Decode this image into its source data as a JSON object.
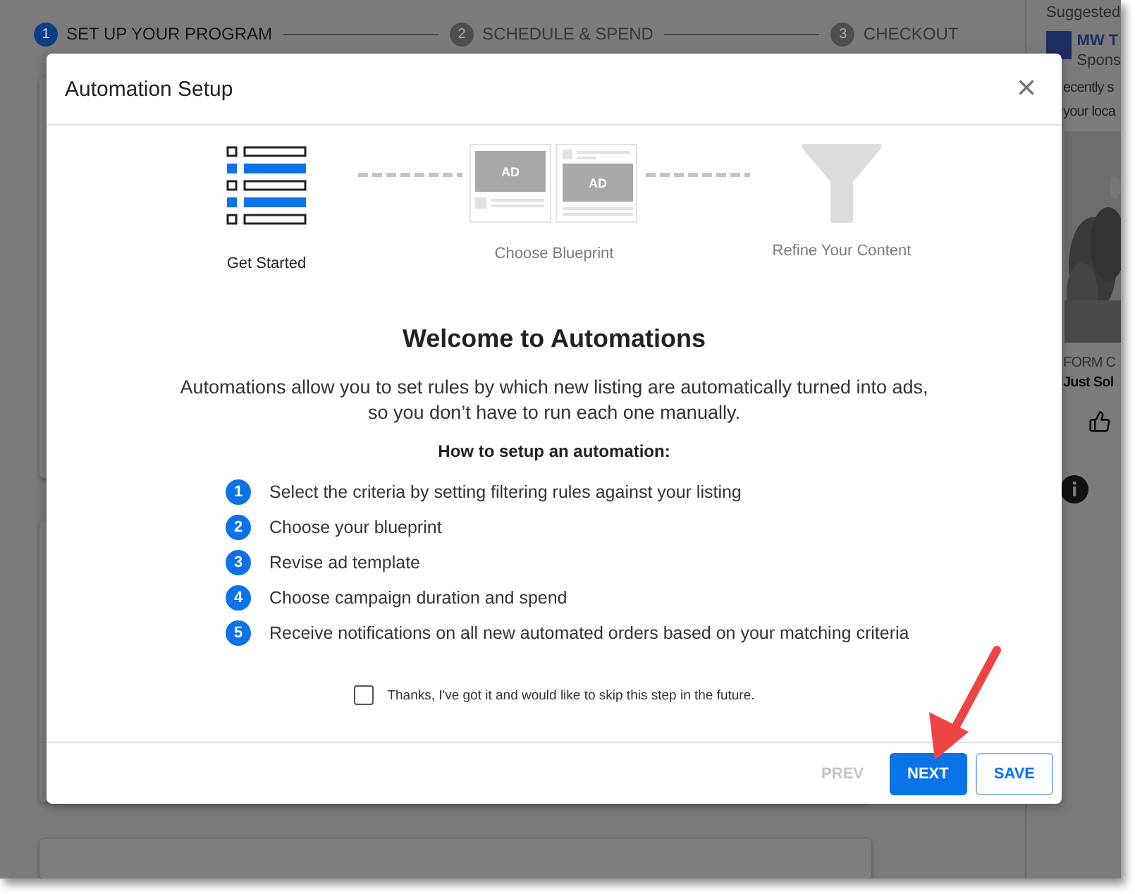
{
  "stepper": [
    {
      "number": "1",
      "label": "SET UP YOUR PROGRAM",
      "selected": true
    },
    {
      "number": "2",
      "label": "SCHEDULE & SPEND",
      "selected": false
    },
    {
      "number": "3",
      "label": "CHECKOUT",
      "selected": false
    }
  ],
  "sidebar": {
    "heading": "Suggested",
    "sponsor_name": "MW T",
    "sponsor_caption": "Spons",
    "lines": [
      "ecently s",
      "your loca"
    ],
    "picture": {
      "kind": "picture"
    },
    "caption": "FORM C",
    "title": "Just Sol"
  },
  "dialog": {
    "title": "Automation Setup",
    "close": "×",
    "steps": [
      {
        "kind": "list",
        "label": "Get Started",
        "selected": true
      },
      {
        "kind": "blueprint",
        "label": "Choose Blueprint",
        "selected": false,
        "badges": [
          "AD",
          "AD"
        ]
      },
      {
        "kind": "funnel",
        "label": "Refine Your Content",
        "selected": false
      }
    ],
    "heading": "Welcome to Automations",
    "intro": "Automations allow you to set rules by which new listing are automatically turned into ads, so you don’t have to run each one manually.",
    "subheading": "How to setup an automation:",
    "items": [
      {
        "number": "1",
        "text": "Select the criteria by setting filtering rules against your listing"
      },
      {
        "number": "2",
        "text": "Choose your blueprint"
      },
      {
        "number": "3",
        "text": "Revise ad template"
      },
      {
        "number": "4",
        "text": "Choose campaign duration and spend"
      },
      {
        "number": "5",
        "text": "Receive notifications on all new automated orders based on your matching criteria"
      }
    ],
    "skip": {
      "label": "Thanks, I've got it and would like to skip this step in the future.",
      "checked": false
    },
    "buttons": [
      {
        "kind": "text",
        "label": "PREV",
        "disabled": true
      },
      {
        "kind": "primary",
        "label": "NEXT",
        "disabled": false
      },
      {
        "kind": "outline",
        "label": "SAVE",
        "disabled": false
      }
    ]
  }
}
